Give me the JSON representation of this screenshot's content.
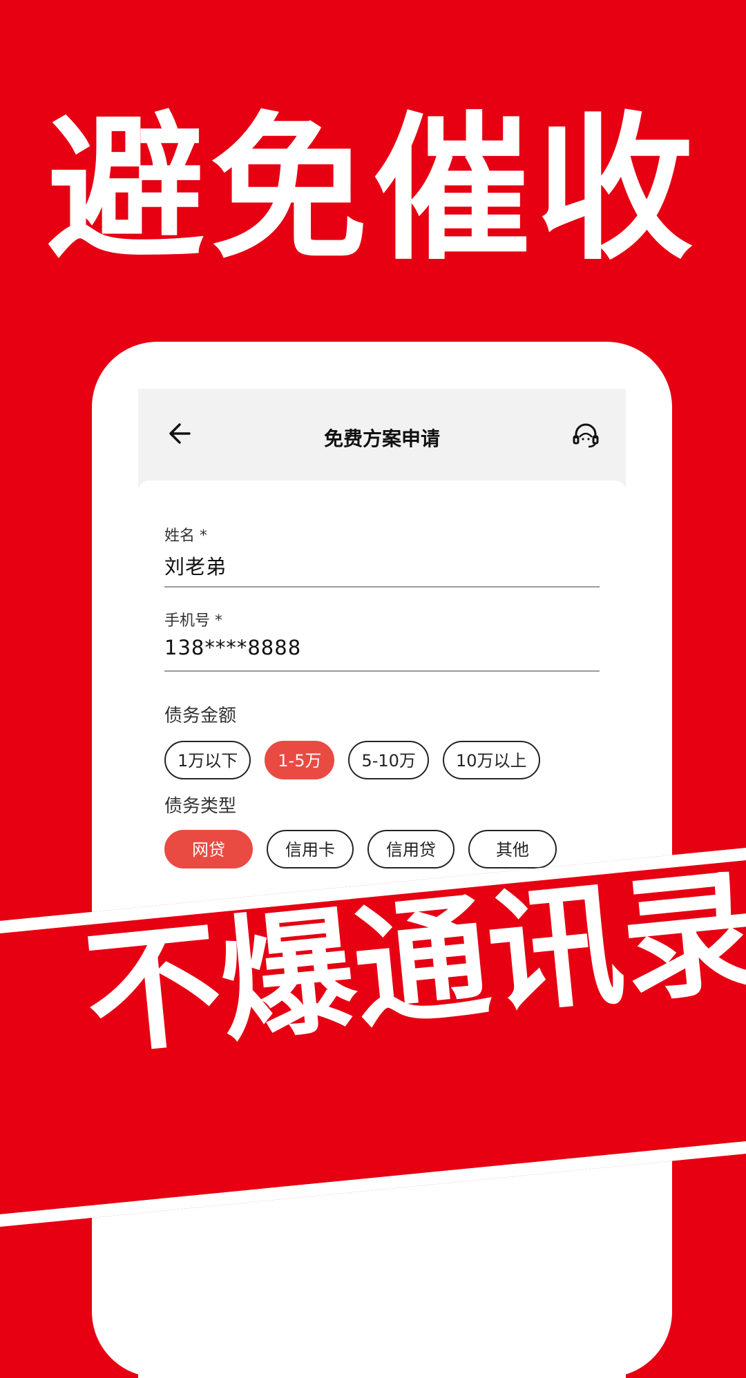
{
  "headline": "避免催收",
  "app": {
    "title": "免费方案申请",
    "back_icon": "arrow-left-icon",
    "support_icon": "headset-support-icon"
  },
  "form": {
    "name": {
      "label": "姓名 *",
      "value": "刘老弟"
    },
    "phone": {
      "label": "手机号 *",
      "value": "138****8888"
    },
    "amount": {
      "label": "债务金额",
      "options": [
        "1万以下",
        "1-5万",
        "5-10万",
        "10万以上"
      ],
      "selected": "1-5万"
    },
    "type": {
      "label": "债务类型",
      "options": [
        "网贷",
        "信用卡",
        "信用贷",
        "其他"
      ],
      "selected": "网贷"
    }
  },
  "banner": "不爆通讯录",
  "colors": {
    "brand_red": "#E60012",
    "chip_selected": "#E94B43"
  }
}
